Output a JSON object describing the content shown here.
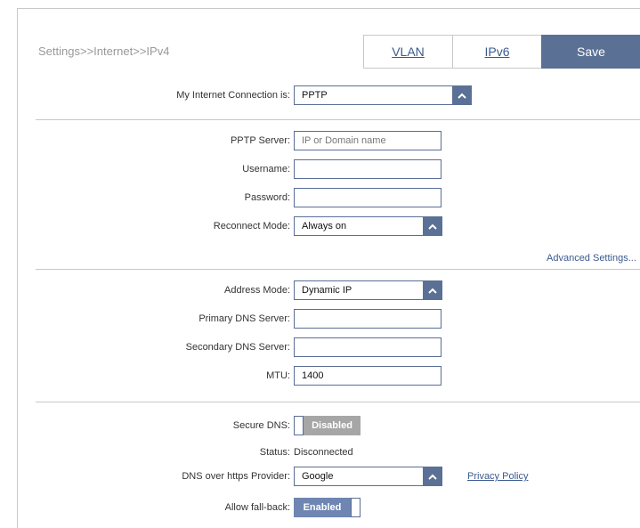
{
  "breadcrumb": "Settings>>Internet>>IPv4",
  "tabs": {
    "vlan": "VLAN",
    "ipv6": "IPv6",
    "save": "Save"
  },
  "connection": {
    "label": "My Internet Connection is:",
    "value": "PPTP"
  },
  "pptp": {
    "server_label": "PPTP Server:",
    "server_placeholder": "IP or Domain name",
    "username_label": "Username:",
    "username_value": "",
    "password_label": "Password:",
    "password_value": "",
    "reconnect_label": "Reconnect Mode:",
    "reconnect_value": "Always on"
  },
  "advanced_link": "Advanced Settings...",
  "address": {
    "mode_label": "Address Mode:",
    "mode_value": "Dynamic IP",
    "primary_dns_label": "Primary DNS Server:",
    "primary_dns_value": "",
    "secondary_dns_label": "Secondary DNS Server:",
    "secondary_dns_value": "",
    "mtu_label": "MTU:",
    "mtu_value": "1400"
  },
  "dns": {
    "secure_label": "Secure DNS:",
    "secure_state": "Disabled",
    "status_label": "Status:",
    "status_value": "Disconnected",
    "provider_label": "DNS over https Provider:",
    "provider_value": "Google",
    "privacy_link": "Privacy Policy",
    "fallback_label": "Allow fall-back:",
    "fallback_state": "Enabled"
  },
  "colors": {
    "accent": "#5b7095",
    "link": "#3a5a8f",
    "disabled": "#a6a6a6",
    "enabled": "#6f86b3"
  }
}
